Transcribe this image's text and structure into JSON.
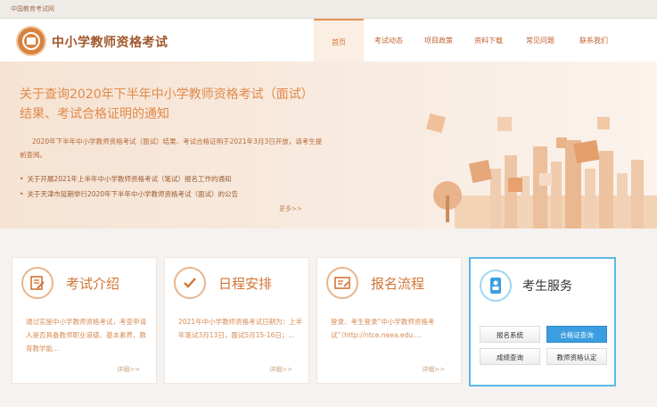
{
  "topbar": {
    "text": "中国教育考试网"
  },
  "header": {
    "site_title": "中小学教师资格考试",
    "nav": [
      {
        "label": "首页",
        "active": true
      },
      {
        "label": "考试动态",
        "active": false
      },
      {
        "label": "项目政策",
        "active": false
      },
      {
        "label": "资料下载",
        "active": false
      },
      {
        "label": "常见问题",
        "active": false
      },
      {
        "label": "联系我们",
        "active": false
      }
    ]
  },
  "banner": {
    "title": "关于查询2020年下半年中小学教师资格考试（面试）结果、考试合格证明的通知",
    "text": "2020年下半年中小学教师资格考试（面试）结果、考试合格证明于2021年3月3日开放，请考生提前查阅。",
    "links": [
      "关于开展2021年上半年中小学教师资格考试（笔试）报名工作的通知",
      "关于天津市延期举行2020年下半年中小学教师资格考试（面试）的公告"
    ],
    "more": "更多>>"
  },
  "cards": [
    {
      "title": "考试介绍",
      "icon": "exam-intro-icon",
      "desc": "通过实施中小学教师资格考试，考查申请人是否具备教师职业道德、基本素养、教育教学能...",
      "more": "详细>>"
    },
    {
      "title": "日程安排",
      "icon": "checkmark-icon",
      "desc": "2021年中小学教师资格考试日期为：上半年笔试3月13日，面试5月15-16日；...",
      "more": "详细>>"
    },
    {
      "title": "报名流程",
      "icon": "registration-icon",
      "desc": "登录、考生登录“中小学教师资格考试”（http://ntce.neea.edu....",
      "more": "详细>>"
    }
  ],
  "service": {
    "title": "考生服务",
    "buttons": [
      {
        "label": "报名系统",
        "active": false
      },
      {
        "label": "合格证查询",
        "active": true
      },
      {
        "label": "成绩查询",
        "active": false
      },
      {
        "label": "教师资格认定",
        "active": false
      }
    ]
  },
  "colors": {
    "accent": "#d9823e",
    "service_border": "#5cb8e6",
    "service_active": "#3c9de0"
  }
}
